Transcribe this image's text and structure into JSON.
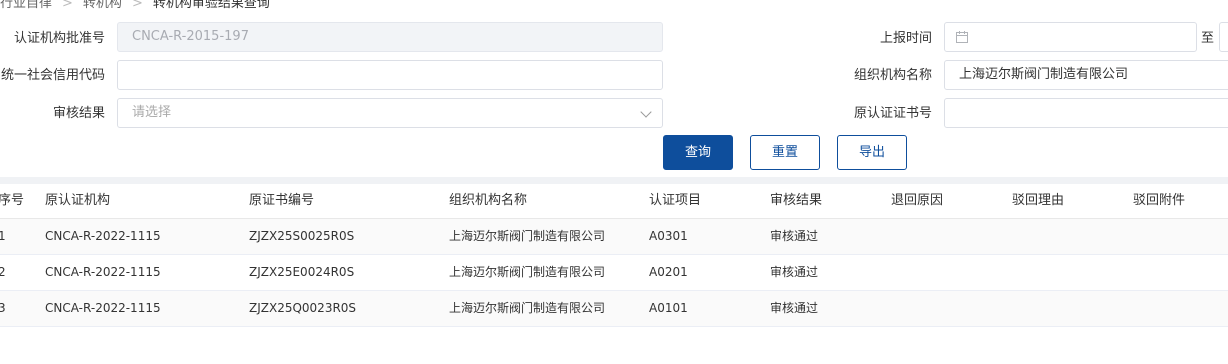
{
  "breadcrumb": [
    "行业自律",
    "转机构",
    "转机构审验结果查询"
  ],
  "form": {
    "approval_no_label": "认证机构批准号",
    "approval_no_value": "CNCA-R-2015-197",
    "report_time_label": "上报时间",
    "report_time_to": "至",
    "credit_code_label": "统一社会信用代码",
    "credit_code_value": "",
    "org_name_label": "组织机构名称",
    "org_name_value": "上海迈尔斯阀门制造有限公司",
    "review_result_label": "审核结果",
    "review_result_placeholder": "请选择",
    "orig_cert_no_label": "原认证证书号",
    "orig_cert_no_value": ""
  },
  "buttons": {
    "query": "查询",
    "reset": "重置",
    "export": "导出"
  },
  "table": {
    "columns": [
      "序号",
      "原认证机构",
      "原证书编号",
      "组织机构名称",
      "认证项目",
      "审核结果",
      "退回原因",
      "驳回理由",
      "驳回附件"
    ],
    "rows": [
      [
        "1",
        "CNCA-R-2022-1115",
        "ZJZX25S0025R0S",
        "上海迈尔斯阀门制造有限公司",
        "A0301",
        "审核通过",
        "",
        "",
        ""
      ],
      [
        "2",
        "CNCA-R-2022-1115",
        "ZJZX25E0024R0S",
        "上海迈尔斯阀门制造有限公司",
        "A0201",
        "审核通过",
        "",
        "",
        ""
      ],
      [
        "3",
        "CNCA-R-2022-1115",
        "ZJZX25Q0023R0S",
        "上海迈尔斯阀门制造有限公司",
        "A0101",
        "审核通过",
        "",
        "",
        ""
      ]
    ]
  },
  "icons": {
    "date_picker": "calendar-icon",
    "select": "chevron-down-icon"
  },
  "colors": {
    "primary": "#0e4e9c",
    "border": "#dcdfe6",
    "disabled_bg": "#f2f4f7"
  }
}
